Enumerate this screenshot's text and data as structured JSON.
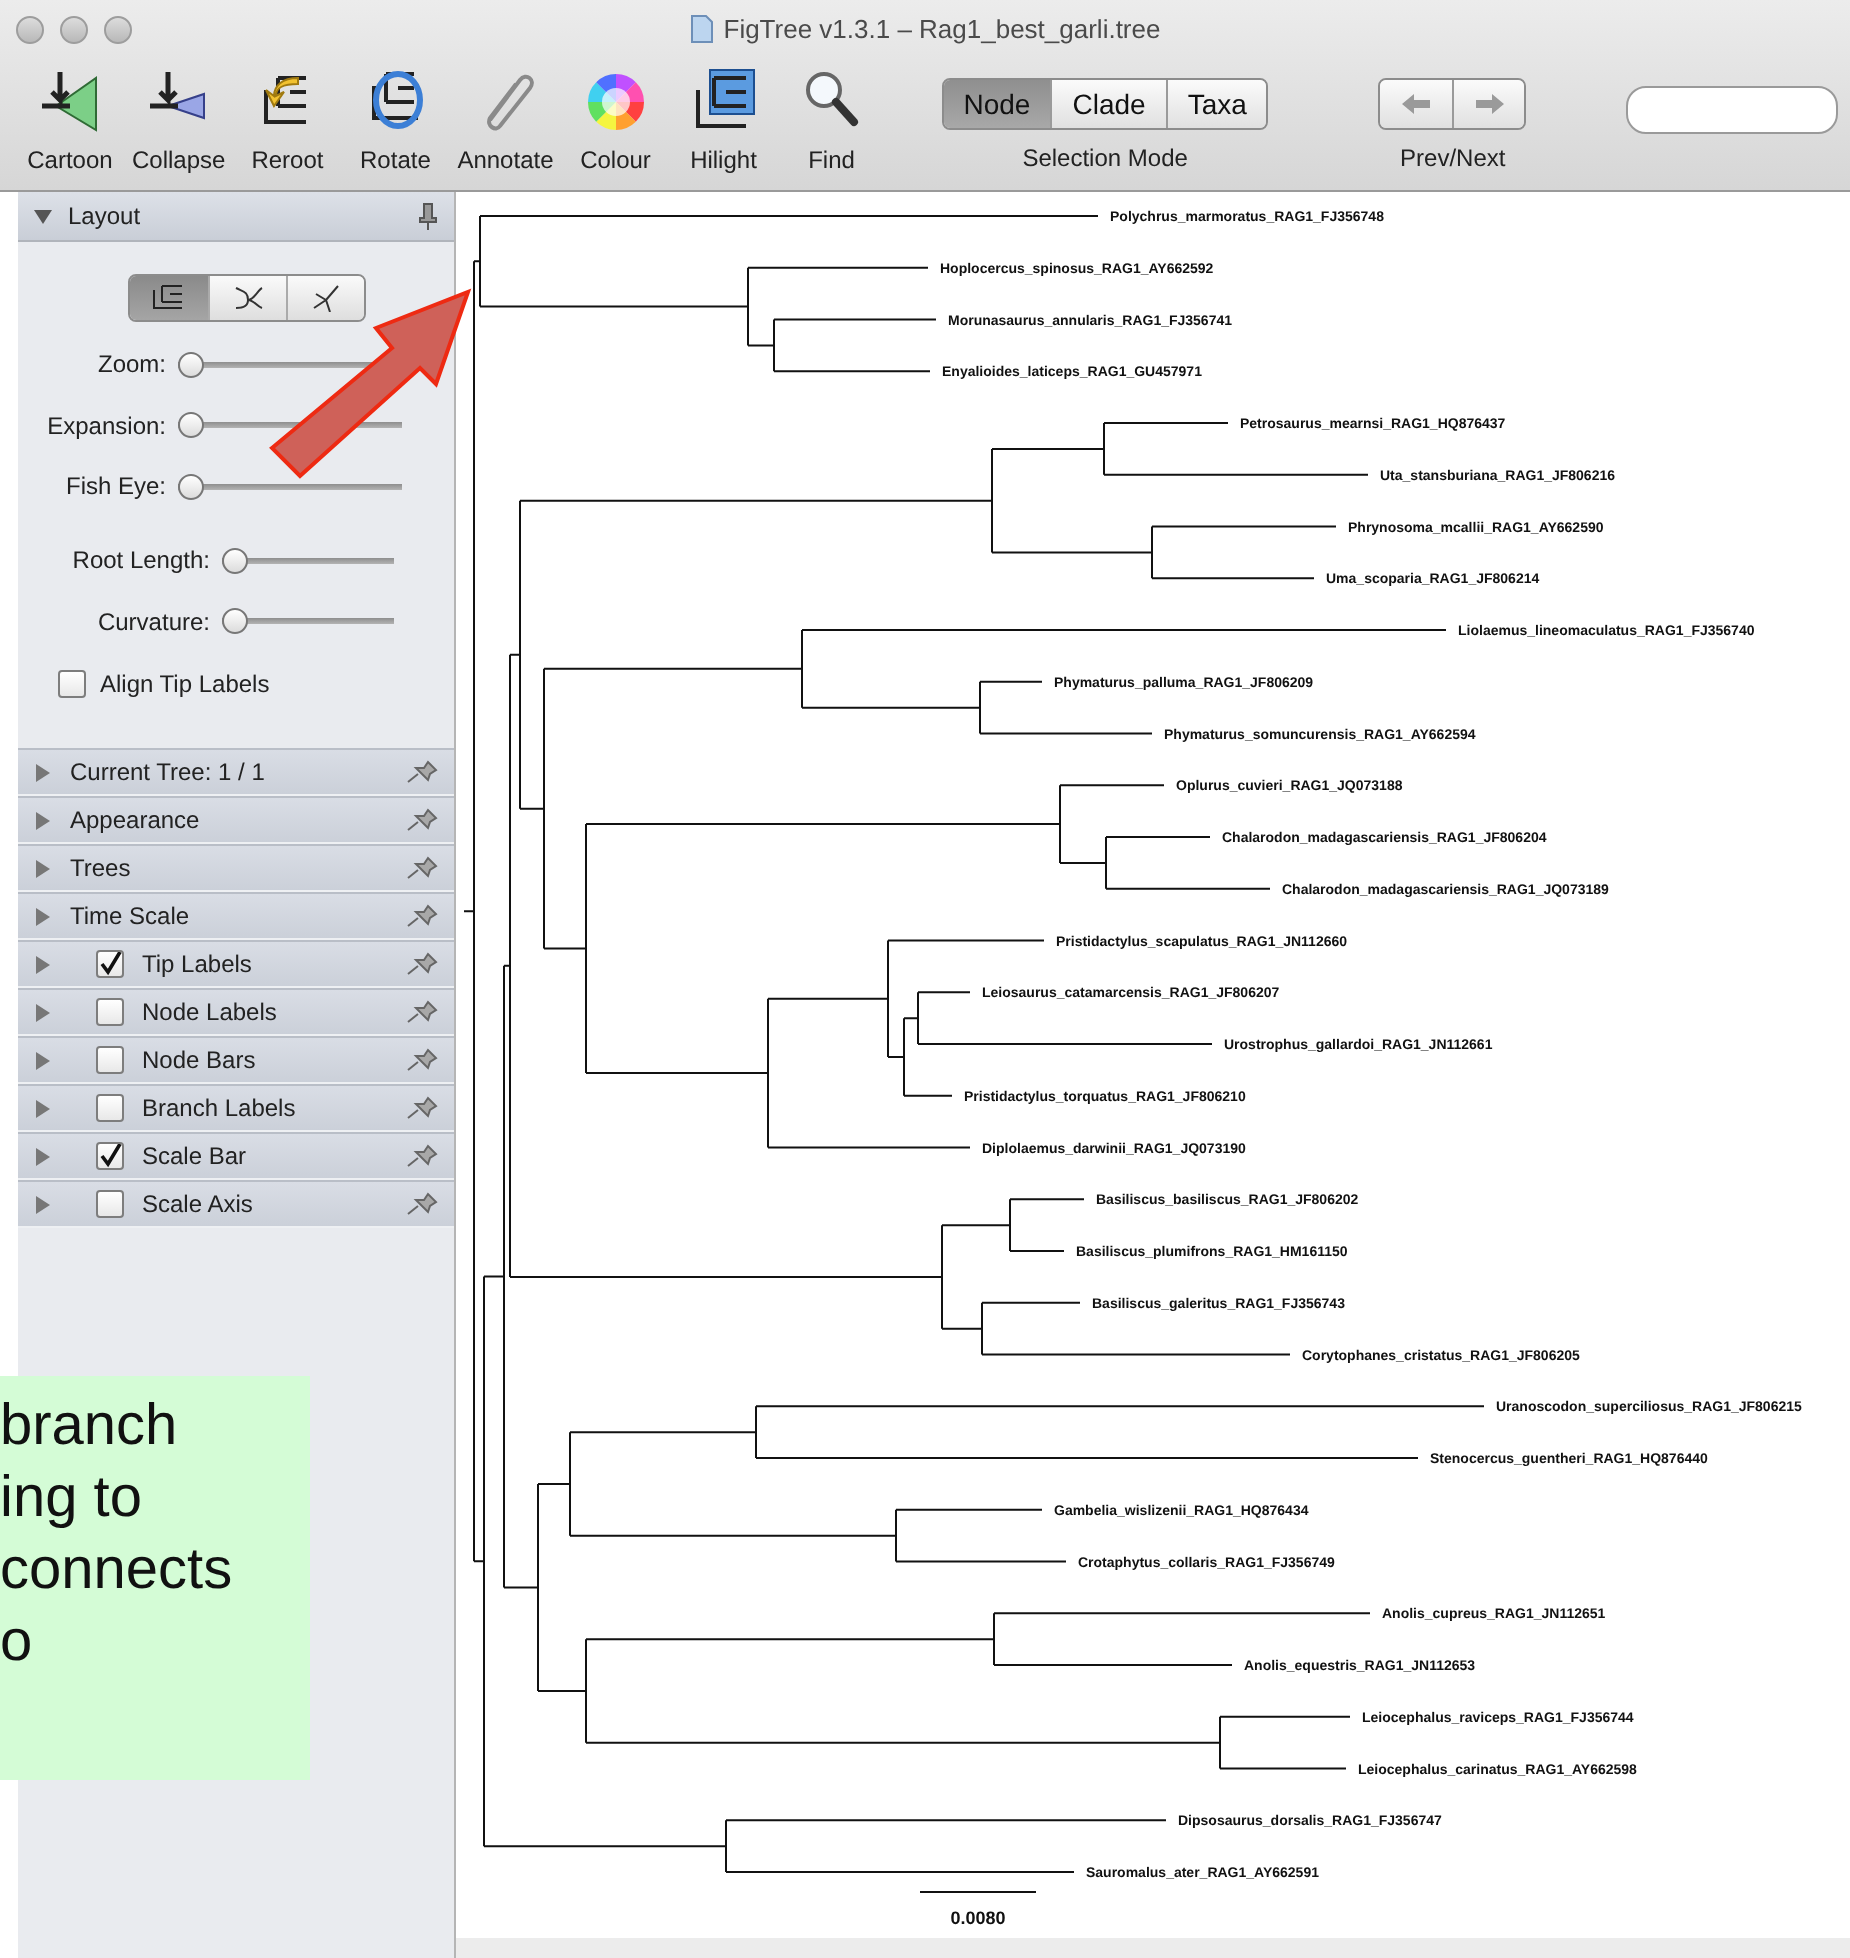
{
  "window": {
    "title": "FigTree v1.3.1 – Rag1_best_garli.tree"
  },
  "toolbar": {
    "tools": [
      {
        "label": "Cartoon",
        "kind": "cartoon"
      },
      {
        "label": "Collapse",
        "kind": "collapse"
      },
      {
        "label": "Reroot",
        "kind": "reroot"
      },
      {
        "label": "Rotate",
        "kind": "rotate"
      },
      {
        "label": "Annotate",
        "kind": "annotate"
      },
      {
        "label": "Colour",
        "kind": "colour"
      },
      {
        "label": "Hilight",
        "kind": "hilight"
      },
      {
        "label": "Find",
        "kind": "find"
      }
    ],
    "selection_mode": {
      "label": "Selection Mode",
      "options": [
        {
          "label": "Node",
          "selected": true
        },
        {
          "label": "Clade",
          "selected": false
        },
        {
          "label": "Taxa",
          "selected": false
        }
      ]
    },
    "prev_next": {
      "label": "Prev/Next"
    }
  },
  "layout_panel": {
    "title": "Layout",
    "expanded": true,
    "layout_types": [
      {
        "kind": "rectangular",
        "selected": true
      },
      {
        "kind": "polar",
        "selected": false
      },
      {
        "kind": "radial",
        "selected": false
      }
    ],
    "view_sliders": [
      {
        "label": "Zoom:",
        "level": 0
      },
      {
        "label": "Expansion:",
        "level": 0
      },
      {
        "label": "Fish Eye:",
        "level": 0
      }
    ],
    "shape_sliders": [
      {
        "label": "Root Length:",
        "level": 0
      },
      {
        "label": "Curvature:",
        "level": 0
      }
    ],
    "align_tip_labels": {
      "label": "Align Tip Labels",
      "checked": false
    }
  },
  "sections": [
    {
      "label": "Current Tree: 1 / 1",
      "kind": "plain",
      "expanded": false
    },
    {
      "label": "Appearance",
      "kind": "plain",
      "expanded": false
    },
    {
      "label": "Trees",
      "kind": "plain",
      "expanded": false
    },
    {
      "label": "Time Scale",
      "kind": "plain",
      "expanded": false
    },
    {
      "label": "Tip Labels",
      "kind": "checkbox",
      "checked": true,
      "expanded": false
    },
    {
      "label": "Node Labels",
      "kind": "checkbox",
      "checked": false,
      "expanded": false
    },
    {
      "label": "Node Bars",
      "kind": "checkbox",
      "checked": false,
      "expanded": false
    },
    {
      "label": "Branch Labels",
      "kind": "checkbox",
      "checked": false,
      "expanded": false
    },
    {
      "label": "Scale Bar",
      "kind": "checkbox",
      "checked": true,
      "expanded": false
    },
    {
      "label": "Scale Axis",
      "kind": "checkbox",
      "checked": false,
      "expanded": false
    }
  ],
  "tree": {
    "children": [
      {
        "children": [
          {
            "label": "Polychrus_marmoratus_RAG1_FJ356748"
          },
          {
            "children": [
              {
                "label": "Hoplocercus_spinosus_RAG1_AY662592"
              },
              {
                "children": [
                  {
                    "label": "Morunasaurus_annularis_RAG1_FJ356741"
                  },
                  {
                    "label": "Enyalioides_laticeps_RAG1_GU457971"
                  }
                ]
              }
            ]
          }
        ]
      },
      {
        "children": [
          {
            "children": [
              {
                "children": [
                  {
                    "children": [
                      {
                        "children": [
                          {
                            "children": [
                              {
                                "label": "Petrosaurus_mearnsi_RAG1_HQ876437"
                              },
                              {
                                "label": "Uta_stansburiana_RAG1_JF806216"
                              }
                            ]
                          },
                          {
                            "children": [
                              {
                                "label": "Phrynosoma_mcallii_RAG1_AY662590"
                              },
                              {
                                "label": "Uma_scoparia_RAG1_JF806214"
                              }
                            ]
                          }
                        ]
                      },
                      {
                        "children": [
                          {
                            "children": [
                              {
                                "label": "Liolaemus_lineomaculatus_RAG1_FJ356740"
                              },
                              {
                                "children": [
                                  {
                                    "label": "Phymaturus_palluma_RAG1_JF806209"
                                  },
                                  {
                                    "label": "Phymaturus_somuncurensis_RAG1_AY662594"
                                  }
                                ]
                              }
                            ]
                          },
                          {
                            "children": [
                              {
                                "children": [
                                  {
                                    "label": "Oplurus_cuvieri_RAG1_JQ073188"
                                  },
                                  {
                                    "children": [
                                      {
                                        "label": "Chalarodon_madagascariensis_RAG1_JF806204"
                                      },
                                      {
                                        "label": "Chalarodon_madagascariensis_RAG1_JQ073189"
                                      }
                                    ]
                                  }
                                ]
                              },
                              {
                                "children": [
                                  {
                                    "children": [
                                      {
                                        "label": "Pristidactylus_scapulatus_RAG1_JN112660"
                                      },
                                      {
                                        "children": [
                                          {
                                            "children": [
                                              {
                                                "label": "Leiosaurus_catamarcensis_RAG1_JF806207"
                                              },
                                              {
                                                "label": "Urostrophus_gallardoi_RAG1_JN112661"
                                              }
                                            ]
                                          },
                                          {
                                            "label": "Pristidactylus_torquatus_RAG1_JF806210"
                                          }
                                        ]
                                      }
                                    ]
                                  },
                                  {
                                    "label": "Diplolaemus_darwinii_RAG1_JQ073190"
                                  }
                                ]
                              }
                            ]
                          }
                        ]
                      }
                    ]
                  },
                  {
                    "children": [
                      {
                        "children": [
                          {
                            "label": "Basiliscus_basiliscus_RAG1_JF806202"
                          },
                          {
                            "label": "Basiliscus_plumifrons_RAG1_HM161150"
                          }
                        ]
                      },
                      {
                        "children": [
                          {
                            "label": "Basiliscus_galeritus_RAG1_FJ356743"
                          },
                          {
                            "label": "Corytophanes_cristatus_RAG1_JF806205"
                          }
                        ]
                      }
                    ]
                  }
                ]
              },
              {
                "children": [
                  {
                    "children": [
                      {
                        "children": [
                          {
                            "label": "Uranoscodon_superciliosus_RAG1_JF806215"
                          },
                          {
                            "label": "Stenocercus_guentheri_RAG1_HQ876440"
                          }
                        ]
                      },
                      {
                        "children": [
                          {
                            "label": "Gambelia_wislizenii_RAG1_HQ876434"
                          },
                          {
                            "label": "Crotaphytus_collaris_RAG1_FJ356749"
                          }
                        ]
                      }
                    ]
                  },
                  {
                    "children": [
                      {
                        "children": [
                          {
                            "label": "Anolis_cupreus_RAG1_JN112651"
                          },
                          {
                            "label": "Anolis_equestris_RAG1_JN112653"
                          }
                        ]
                      },
                      {
                        "children": [
                          {
                            "label": "Leiocephalus_raviceps_RAG1_FJ356744"
                          },
                          {
                            "label": "Leiocephalus_carinatus_RAG1_AY662598"
                          }
                        ]
                      }
                    ]
                  }
                ]
              }
            ]
          },
          {
            "children": [
              {
                "label": "Dipsosaurus_dorsalis_RAG1_FJ356747"
              },
              {
                "label": "Sauromalus_ater_RAG1_AY662591"
              }
            ]
          }
        ]
      }
    ]
  },
  "scale_bar": {
    "label": "0.0080"
  },
  "callout": {
    "text": "branch\ning to\nconnects\no"
  }
}
